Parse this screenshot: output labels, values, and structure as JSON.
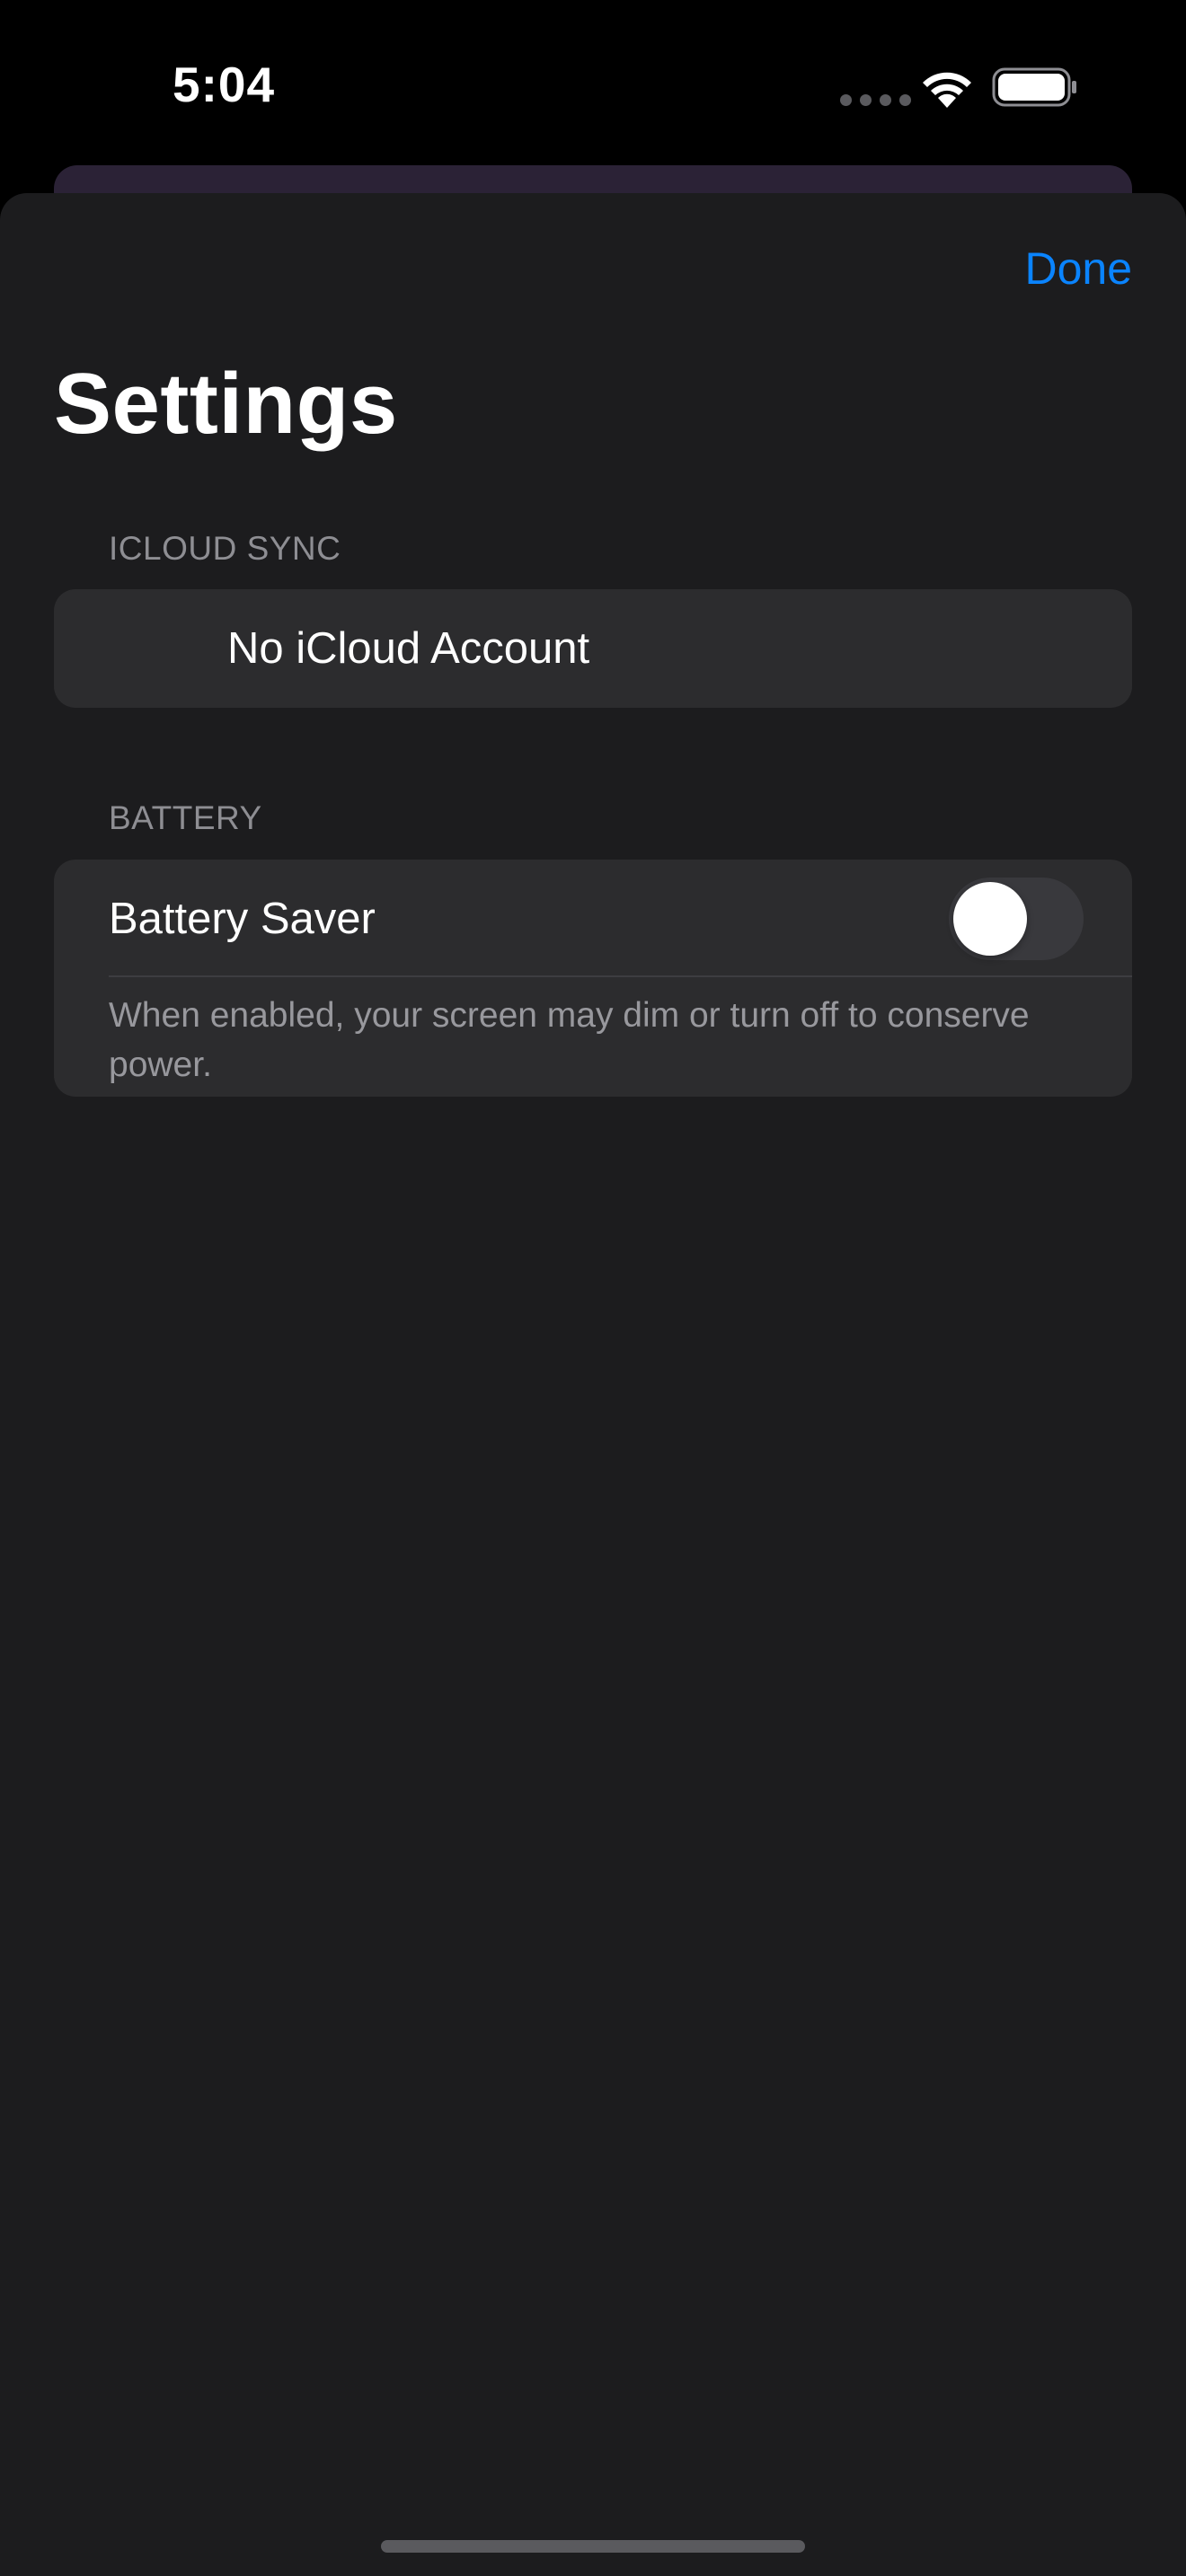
{
  "status_bar": {
    "time": "5:04",
    "wifi_icon": "wifi-icon",
    "battery_icon": "battery-icon"
  },
  "nav": {
    "done_label": "Done",
    "accent_color": "#0a84ff"
  },
  "page": {
    "title": "Settings"
  },
  "sections": {
    "icloud": {
      "header": "ICLOUD SYNC",
      "row_label": "No iCloud Account"
    },
    "battery": {
      "header": "BATTERY",
      "row_label": "Battery Saver",
      "toggle_on": false,
      "footnote": "When enabled, your screen may dim or turn off to conserve power."
    }
  }
}
